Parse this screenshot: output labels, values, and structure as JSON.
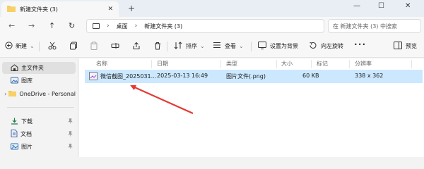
{
  "window": {
    "tab_title": "新建文件夹 (3)",
    "close_tab": "✕",
    "new_tab": "+",
    "controls": {
      "minimize": "—",
      "maximize": "☐",
      "close": "✕"
    }
  },
  "nav": {
    "back": "←",
    "forward": "→",
    "up": "↑",
    "refresh": "↻",
    "breadcrumb": [
      "桌面",
      "新建文件夹 (3)"
    ],
    "chevron": "›",
    "more_chevron": "›",
    "search_placeholder": "在 新建文件夹 (3) 中搜索"
  },
  "toolbar": {
    "new_label": "新建",
    "sort_label": "排序",
    "view_label": "查看",
    "set_wallpaper_label": "设置为背景",
    "rotate_left_label": "向左旋转",
    "more_label": "•••",
    "preview_label": "预览",
    "caret": "⌄"
  },
  "sidebar": {
    "items": [
      {
        "label": "主文件夹",
        "icon": "home-icon",
        "selected": true
      },
      {
        "label": "图库",
        "icon": "gallery-icon"
      },
      {
        "label": "OneDrive - Personal",
        "icon": "folder-icon",
        "expandable": true
      },
      {
        "label": "下载",
        "icon": "download-icon",
        "pinned": true
      },
      {
        "label": "文档",
        "icon": "document-icon",
        "pinned": true
      },
      {
        "label": "图片",
        "icon": "picture-icon",
        "pinned": true
      }
    ],
    "pin_glyph": "📌"
  },
  "columns": [
    "名称",
    "日期",
    "类型",
    "大小",
    "标记",
    "分辨率"
  ],
  "files": [
    {
      "name": "微信截图_2025031...",
      "date": "2025-03-13 16:49",
      "type": "图片文件(.png)",
      "size": "60 KB",
      "tag": "",
      "resolution": "338 x 362"
    }
  ],
  "colors": {
    "selection": "#cce8ff",
    "accent": "#0067c0",
    "arrow": "#e53935",
    "folder": "#f3c544"
  }
}
